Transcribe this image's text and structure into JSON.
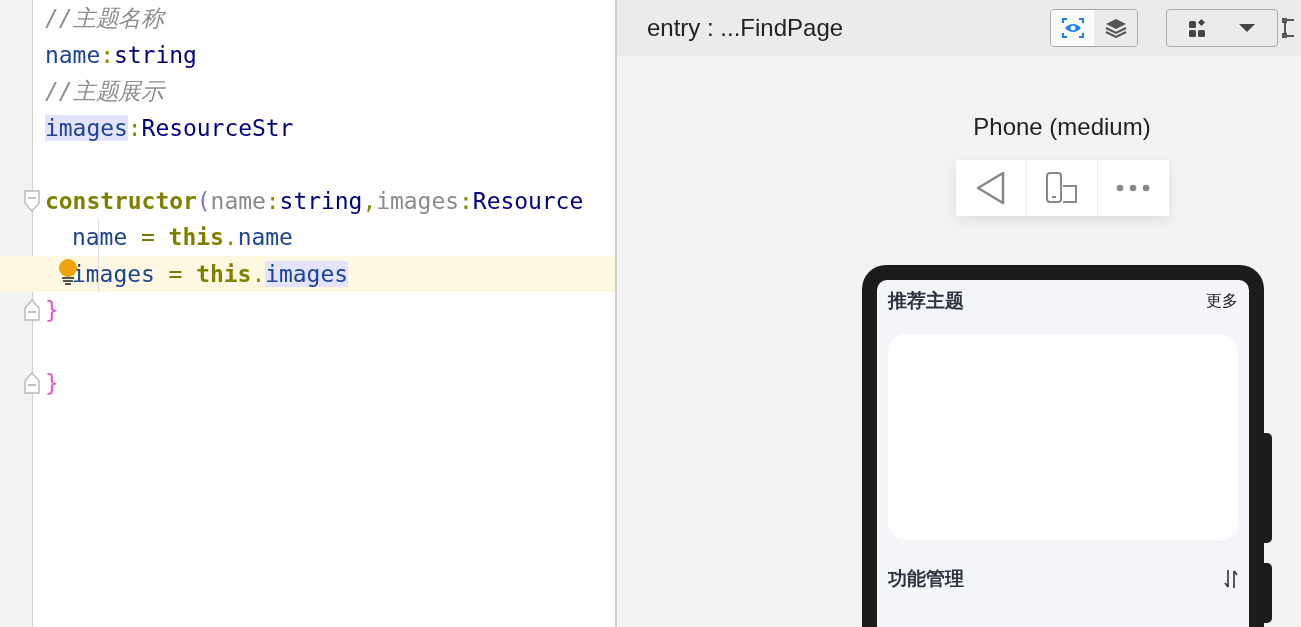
{
  "editor": {
    "lines": [
      {
        "kind": "group",
        "children": [
          {
            "kind": "code",
            "current": false,
            "tokens": [
              {
                "kind": "comment",
                "text": "//主题名称",
                "highlighted": false
              }
            ]
          },
          {
            "kind": "code",
            "current": false,
            "tokens": [
              {
                "kind": "field",
                "text": "name",
                "highlighted": false
              },
              {
                "kind": "punct",
                "text": ":",
                "highlighted": false
              },
              {
                "kind": "type",
                "text": "string",
                "highlighted": false
              }
            ]
          },
          {
            "kind": "code",
            "current": false,
            "tokens": [
              {
                "kind": "comment",
                "text": "//主题展示",
                "highlighted": false
              }
            ]
          },
          {
            "kind": "code",
            "current": false,
            "tokens": [
              {
                "kind": "field",
                "text": "images",
                "highlighted": true
              },
              {
                "kind": "punct",
                "text": ":",
                "highlighted": false
              },
              {
                "kind": "type",
                "text": "ResourceStr",
                "highlighted": false
              }
            ]
          },
          {
            "kind": "blank"
          },
          {
            "kind": "fold-start",
            "current": false,
            "tokens": [
              {
                "kind": "keyword",
                "text": "constructor",
                "highlighted": false
              },
              {
                "kind": "paren",
                "text": "(",
                "highlighted": false
              },
              {
                "kind": "param",
                "text": "name",
                "highlighted": false
              },
              {
                "kind": "punct",
                "text": ":",
                "highlighted": false
              },
              {
                "kind": "type",
                "text": "string",
                "highlighted": false
              },
              {
                "kind": "punct",
                "text": ",",
                "highlighted": false
              },
              {
                "kind": "param",
                "text": "images",
                "highlighted": false
              },
              {
                "kind": "punct",
                "text": ":",
                "highlighted": false
              },
              {
                "kind": "type",
                "text": "Resource",
                "highlighted": false
              }
            ],
            "children": [
              {
                "kind": "code",
                "current": false,
                "tokens": [
                  {
                    "kind": "field",
                    "text": "name",
                    "highlighted": false
                  },
                  {
                    "kind": "op",
                    "text": " = ",
                    "highlighted": false
                  },
                  {
                    "kind": "keyword",
                    "text": "this",
                    "highlighted": false
                  },
                  {
                    "kind": "punct",
                    "text": ".",
                    "highlighted": false
                  },
                  {
                    "kind": "field",
                    "text": "name",
                    "highlighted": false
                  }
                ]
              },
              {
                "kind": "code",
                "current": true,
                "tokens": [
                  {
                    "kind": "field",
                    "text": "images",
                    "highlighted": false
                  },
                  {
                    "kind": "op",
                    "text": " = ",
                    "highlighted": false
                  },
                  {
                    "kind": "keyword",
                    "text": "this",
                    "highlighted": false
                  },
                  {
                    "kind": "punct",
                    "text": ".",
                    "highlighted": false
                  },
                  {
                    "kind": "field",
                    "text": "images",
                    "highlighted": true
                  }
                ]
              }
            ]
          },
          {
            "kind": "fold-end",
            "current": false,
            "tokens": [
              {
                "kind": "brace",
                "text": "}",
                "highlighted": false
              }
            ]
          },
          {
            "kind": "blank"
          }
        ]
      },
      {
        "kind": "fold-end",
        "current": false,
        "tokens": [
          {
            "kind": "brace",
            "text": "}",
            "highlighted": false
          }
        ]
      }
    ]
  },
  "preview": {
    "title": "entry : ...FindPage",
    "view_buttons": [
      {
        "kind": "inspect",
        "selected": true
      },
      {
        "kind": "layers",
        "selected": false
      }
    ],
    "device_label": "Phone (medium)",
    "phone": {
      "header_title": "推荐主题",
      "header_action": "更多",
      "section_title": "功能管理"
    }
  }
}
